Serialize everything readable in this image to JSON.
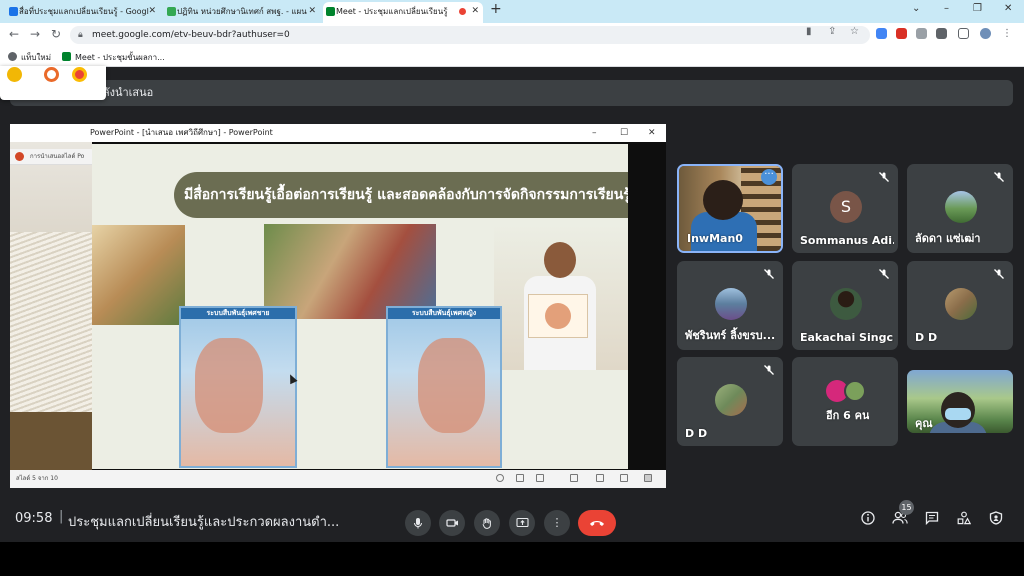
{
  "browser": {
    "tabs": [
      {
        "label": "สื่อที่ประชุมแลกเปลี่ยนเรียนรู้ - Google",
        "favicon_color": "#1a73e8"
      },
      {
        "label": "ปฏิทิน หน่วยศึกษานิเทศก์ สพฐ. - แผน",
        "favicon_color": "#34a853"
      },
      {
        "label": "Meet - ประชุมแลกเปลี่ยนเรียนรู้",
        "favicon_color": "#00832d"
      }
    ],
    "url": "meet.google.com/etv-beuv-bdr?authuser=0",
    "bookmarks": [
      {
        "label": "แท็บใหม่",
        "icon_color": "#5f6368"
      },
      {
        "label": "Meet - ประชุมขั้นผลกา...",
        "icon_color": "#00832d"
      }
    ]
  },
  "meet": {
    "presenting_label": "กำลังนำเสนอ",
    "presentation": {
      "window_title": "PowerPoint - [นำเสนอ เพศวิถีศึกษา] - PowerPoint",
      "taskbar_item": "การนำเสนอสไลด์ Po",
      "status_text": "สไลด์ 5 จาก 10",
      "slide_title": "มีสื่อการเรียนรู้เอื้อต่อการเรียนรู้ และสอดคล้องกับการจัดกิจกรรมการเรียนรู้",
      "poster_male_title": "ระบบสืบพันธุ์เพศชาย",
      "poster_female_title": "ระบบสืบพันธุ์เพศหญิง"
    },
    "participants": [
      {
        "name": "InwMan0",
        "avatar_letter": "",
        "avatar_color": "",
        "muted": false
      },
      {
        "name": "Sommanus Adi...",
        "avatar_letter": "S",
        "avatar_color": "#795548",
        "muted": true
      },
      {
        "name": "ลัดดา แซ่เฒ่า",
        "avatar_letter": "",
        "avatar_color": "#6a9a57",
        "muted": true
      },
      {
        "name": "พัชรินทร์ ลิ้งขรบ...",
        "avatar_letter": "",
        "avatar_color": "#5c7e9e",
        "muted": true
      },
      {
        "name": "Eakachai Singc...",
        "avatar_letter": "",
        "avatar_color": "#3d5a40",
        "muted": true
      },
      {
        "name": "D D",
        "avatar_letter": "",
        "avatar_color": "#8a6d4a",
        "muted": true
      },
      {
        "name": "D D",
        "avatar_letter": "",
        "avatar_color": "#6e8a5a",
        "muted": true
      },
      {
        "name": "อีก 6 คน",
        "avatar_letter": "",
        "avatar_color": "",
        "muted": false
      },
      {
        "name": "คุณ",
        "avatar_letter": "",
        "avatar_color": "",
        "muted": false
      }
    ],
    "clock": "09:58",
    "meeting_title": "ประชุมแลกเปลี่ยนเรียนรู้และประกวดผลงานดำ...",
    "people_count": "15",
    "colors": {
      "end_call": "#ea4335",
      "tile": "#3c4043",
      "background": "#202124",
      "active_speaker_border": "#8ab4f8"
    }
  }
}
